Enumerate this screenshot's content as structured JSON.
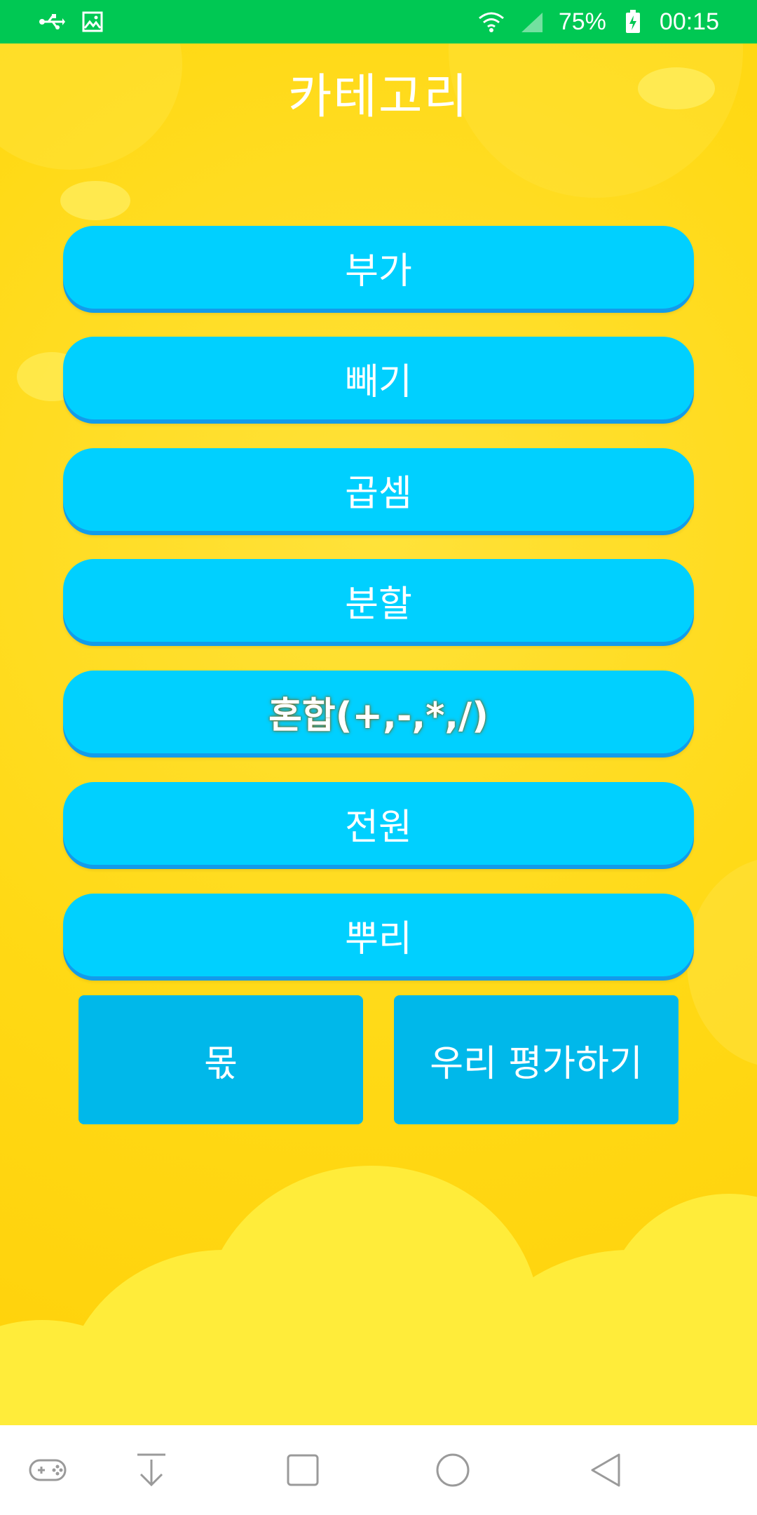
{
  "status_bar": {
    "battery_percent": "75%",
    "time": "00:15",
    "left_icons": [
      "usb-icon",
      "image-icon"
    ],
    "right_icons": [
      "wifi-icon",
      "signal-icon",
      "battery-charging-icon"
    ]
  },
  "header": {
    "title": "카테고리"
  },
  "categories": [
    {
      "label": "부가"
    },
    {
      "label": "빼기"
    },
    {
      "label": "곱셈"
    },
    {
      "label": "분할"
    },
    {
      "label": "혼합(+,-,*,/)"
    },
    {
      "label": "전원"
    },
    {
      "label": "뿌리"
    }
  ],
  "actions": {
    "left_label": "몫",
    "right_label": "우리 평가하기"
  },
  "nav_bar": {
    "icons": [
      "gamepad-icon",
      "download-icon",
      "recents-square-icon",
      "home-circle-icon",
      "back-triangle-icon"
    ]
  },
  "colors": {
    "status_bar": "#00C853",
    "background": "#FFDB1A",
    "category_button": "#00D0FF",
    "category_button_shadow": "#139BEA",
    "action_button": "#00B8EA"
  }
}
